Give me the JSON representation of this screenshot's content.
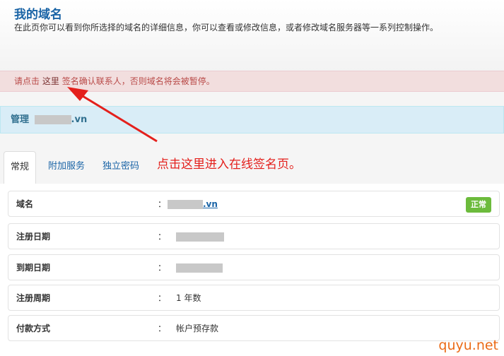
{
  "header": {
    "title": "我的域名",
    "description": "在此页你可以看到你所选择的域名的详细信息，你可以查看或修改信息，或者修改域名服务器等一系列控制操作。"
  },
  "alert": {
    "prefix": "请点击",
    "link_text": "这里",
    "suffix": "签名确认联系人，否则域名将会被暂停。"
  },
  "manage_bar": {
    "prefix": "管理",
    "suffix": ".vn"
  },
  "tabs": [
    {
      "label": "常规",
      "active": true
    },
    {
      "label": "附加服务",
      "active": false
    },
    {
      "label": "独立密码",
      "active": false
    }
  ],
  "annotation": "点击这里进入在线签名页。",
  "details": {
    "domain": {
      "label": "域名",
      "colon": "：",
      "suffix": ".vn",
      "status": "正常"
    },
    "reg_date": {
      "label": "注册日期",
      "colon": "："
    },
    "exp_date": {
      "label": "到期日期",
      "colon": "："
    },
    "reg_period": {
      "label": "注册周期",
      "colon": "：",
      "value": "1 年数"
    },
    "payment": {
      "label": "付款方式",
      "colon": "：",
      "value": "帐户预存款"
    }
  },
  "watermark": "quyu.net",
  "colors": {
    "title": "#1a64a6",
    "alert_bg": "#f2dede",
    "info_bg": "#d9edf7",
    "status_green": "#6cbb3c",
    "annotation_red": "#e4201c"
  }
}
